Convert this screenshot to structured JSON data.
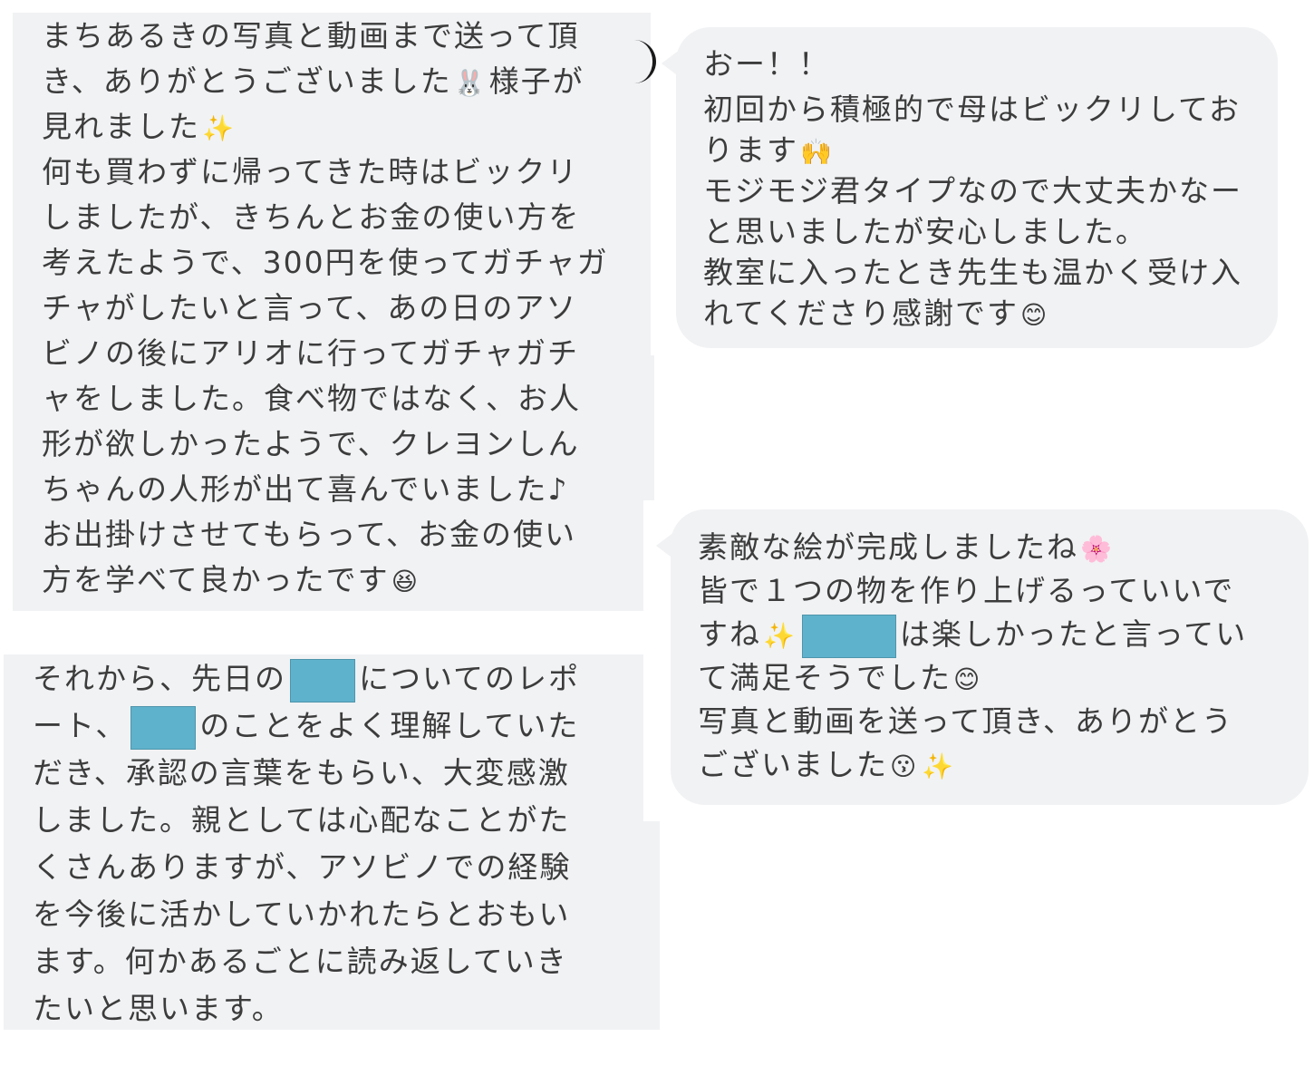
{
  "screenshot_1": {
    "lines": [
      {
        "text": "まちあるきの写真と動画まで送って頂"
      },
      {
        "text": "き、ありがとうございました",
        "emoji": "🐰",
        "after": "様子が"
      },
      {
        "text": "見れました",
        "emoji": "✨"
      },
      {
        "text": "何も買わずに帰ってきた時はビックリ"
      },
      {
        "text": "しましたが、きちんとお金の使い方を"
      },
      {
        "text": "考えたようで、300円を使ってガチャガ"
      },
      {
        "text": "チャがしたいと言って、あの日のアソ"
      },
      {
        "text": "ビノの後にアリオに行ってガチャガチ"
      },
      {
        "text": "ャをしました。食べ物ではなく、お人"
      },
      {
        "text": "形が欲しかったようで、クレヨンしん"
      },
      {
        "text": "ちゃんの人形が出て喜んでいました♪"
      },
      {
        "text": "お出掛けさせてもらって、お金の使い"
      },
      {
        "text": "方を学べて良かったです",
        "emoji": "😆"
      }
    ]
  },
  "reply_1": {
    "lines": [
      {
        "text": "おー！！"
      },
      {
        "text": "初回から積極的で母はビックリしてお"
      },
      {
        "text": "ります",
        "emoji": "🙌"
      },
      {
        "text": "モジモジ君タイプなので大丈夫かなー"
      },
      {
        "text": "と思いましたが安心しました。"
      },
      {
        "text": "教室に入ったとき先生も温かく受け入"
      },
      {
        "text": "れてくださり感謝です",
        "emoji": "😊"
      }
    ]
  },
  "screenshot_2": {
    "lines": [
      {
        "text": "それから、先日の",
        "redacted": true,
        "after": "についてのレポ"
      },
      {
        "text": "ート、",
        "redacted": true,
        "after": "のことをよく理解していた"
      },
      {
        "text": "だき、承認の言葉をもらい、大変感激"
      },
      {
        "text": "しました。親としては心配なことがた"
      },
      {
        "text": "くさんありますが、アソビノでの経験"
      },
      {
        "text": "を今後に活かしていかれたらとおもい"
      },
      {
        "text": "ます。何かあるごとに読み返していき"
      },
      {
        "text": "たいと思います。"
      }
    ]
  },
  "reply_2": {
    "lines": [
      {
        "text": "素敵な絵が完成しましたね",
        "emoji": "🌸"
      },
      {
        "text": "皆で１つの物を作り上げるっていいで"
      },
      {
        "text": "すね",
        "emoji": "✨",
        "redacted": true,
        "after": "は楽しかったと言ってい"
      },
      {
        "text": "て満足そうでした",
        "emoji": "😊"
      },
      {
        "text": "写真と動画を送って頂き、ありがとう"
      },
      {
        "text": "ございました",
        "emoji": "😗",
        "emoji2": "✨"
      }
    ]
  },
  "colors": {
    "bubble": "#f1f2f4",
    "text": "#3c3c3c",
    "redaction": "#5fb2cc"
  }
}
